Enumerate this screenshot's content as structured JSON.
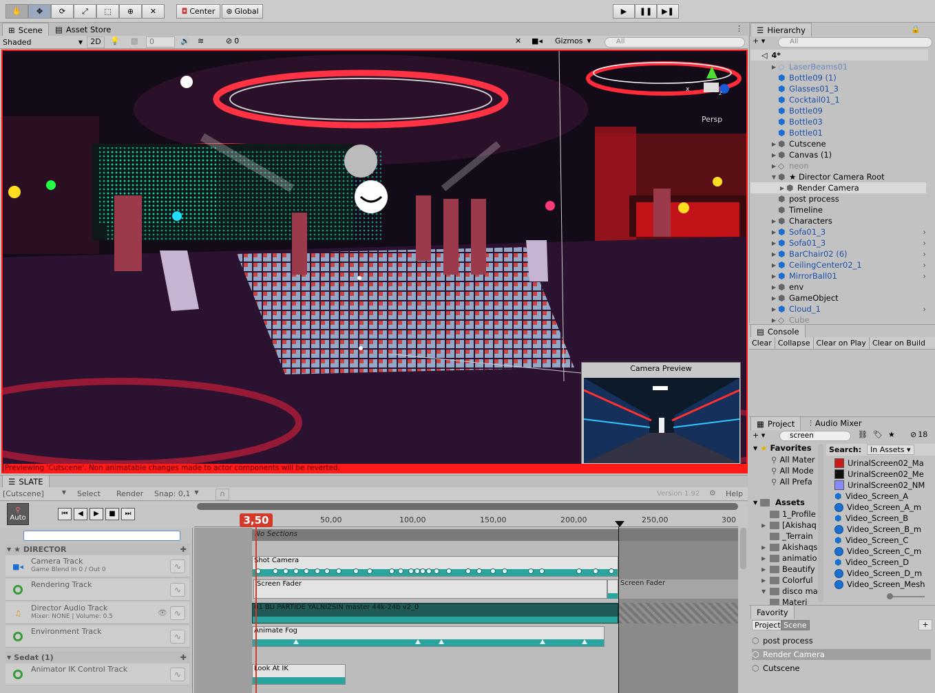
{
  "toolbar": {
    "tools": [
      "hand-tool",
      "move-tool",
      "rotate-tool",
      "scale-tool",
      "rect-tool",
      "transform-tool",
      "custom-tool"
    ],
    "pivot": "Center",
    "space": "Global"
  },
  "scene": {
    "tabs": [
      "Scene",
      "Asset Store"
    ],
    "shading": "Shaded",
    "mode2d": "2D",
    "counter": "0",
    "hidden_count": "0",
    "gizmos": "Gizmos",
    "search_placeholder": "All",
    "persp": "Persp",
    "warning": "Previewing 'Cutscene'. Non animatable changes made to actor components will be reverted.",
    "camera_preview": "Camera Preview"
  },
  "hierarchy": {
    "title": "Hierarchy",
    "search_placeholder": "All",
    "scene_name": "4*",
    "items": [
      {
        "label": "LaserBeams01",
        "type": "prefab-disabled",
        "arrow": "▶"
      },
      {
        "label": "Bottle09 (1)",
        "type": "prefab",
        "arrow": ""
      },
      {
        "label": "Glasses01_3",
        "type": "prefab",
        "arrow": ""
      },
      {
        "label": "Cocktail01_1",
        "type": "prefab",
        "arrow": ""
      },
      {
        "label": "Bottle09",
        "type": "prefab",
        "arrow": ""
      },
      {
        "label": "Bottle03",
        "type": "prefab",
        "arrow": ""
      },
      {
        "label": "Bottle01",
        "type": "prefab",
        "arrow": ""
      },
      {
        "label": "Cutscene",
        "type": "object",
        "arrow": "▶"
      },
      {
        "label": "Canvas (1)",
        "type": "object",
        "arrow": "▶"
      },
      {
        "label": "neon",
        "type": "disabled",
        "arrow": "▶"
      },
      {
        "label": "★ Director Camera Root",
        "type": "object",
        "arrow": "▼"
      },
      {
        "label": "Render Camera",
        "type": "object-selected",
        "arrow": "▶"
      },
      {
        "label": "post process",
        "type": "object",
        "arrow": ""
      },
      {
        "label": "Timeline",
        "type": "object",
        "arrow": ""
      },
      {
        "label": "Characters",
        "type": "object",
        "arrow": "▶"
      },
      {
        "label": "Sofa01_3",
        "type": "prefab",
        "arrow": "▶"
      },
      {
        "label": "Sofa01_3",
        "type": "prefab",
        "arrow": "▶"
      },
      {
        "label": "BarChair02 (6)",
        "type": "prefab",
        "arrow": "▶"
      },
      {
        "label": "CeilingCenter02_1",
        "type": "prefab",
        "arrow": "▶"
      },
      {
        "label": "MirrorBall01",
        "type": "prefab",
        "arrow": "▶"
      },
      {
        "label": "env",
        "type": "object",
        "arrow": "▶"
      },
      {
        "label": "GameObject",
        "type": "object",
        "arrow": "▶"
      },
      {
        "label": "Cloud_1",
        "type": "prefab",
        "arrow": "▶"
      },
      {
        "label": "Cube",
        "type": "disabled",
        "arrow": "▶"
      }
    ]
  },
  "console": {
    "title": "Console",
    "buttons": [
      "Clear",
      "Collapse",
      "Clear on Play",
      "Clear on Build"
    ]
  },
  "project": {
    "tabs": [
      "Project",
      "Audio Mixer"
    ],
    "search": "screen",
    "count": "18",
    "search_label": "Search:",
    "search_scope": "In Assets",
    "favorites_title": "Favorites",
    "favorites": [
      "All Mater",
      "All Mode",
      "All Prefa"
    ],
    "assets_title": "Assets",
    "folders": [
      "1_Profile",
      "[Akishaq",
      "_Terrain",
      "Akishaqs",
      "animatio",
      "Beautify",
      "Colorful",
      "disco ma",
      "Materi"
    ],
    "results": [
      {
        "label": "UrinalScreen02_Ma",
        "kind": "swatch",
        "color": "#cc1a1a"
      },
      {
        "label": "UrinalScreen02_Me",
        "kind": "swatch",
        "color": "#111111"
      },
      {
        "label": "UrinalScreen02_NM",
        "kind": "swatch",
        "color": "#8888ff"
      },
      {
        "label": "Video_Screen_A",
        "kind": "prefab"
      },
      {
        "label": "Video_Screen_A_m",
        "kind": "sphere"
      },
      {
        "label": "Video_Screen_B",
        "kind": "prefab"
      },
      {
        "label": "Video_Screen_B_m",
        "kind": "sphere"
      },
      {
        "label": "Video_Screen_C",
        "kind": "prefab"
      },
      {
        "label": "Video_Screen_C_m",
        "kind": "sphere"
      },
      {
        "label": "Video_Screen_D",
        "kind": "prefab"
      },
      {
        "label": "Video_Screen_D_m",
        "kind": "sphere"
      },
      {
        "label": "Video_Screen_Mesh",
        "kind": "sphere"
      }
    ]
  },
  "favority": {
    "title": "Favority",
    "tabs": [
      "Project",
      "Scene"
    ],
    "add": "+",
    "items": [
      "post process",
      "Render Camera",
      "Cutscene"
    ]
  },
  "slate": {
    "title": "SLATE",
    "cutscene": "[Cutscene]",
    "select": "Select",
    "render": "Render",
    "snap": "Snap: 0,1",
    "version": "Version 1.92",
    "help": "Help",
    "auto": "Auto",
    "current_time": "3,50",
    "ruler": [
      "50,00",
      "100,00",
      "150,00",
      "200,00",
      "250,00",
      "300"
    ],
    "sections": "No Sections",
    "groups": [
      {
        "name": "★ DIRECTOR"
      },
      {
        "name": "Sedat (1)"
      }
    ],
    "tracks": [
      {
        "name": "Camera Track",
        "sub": "Game Blend In 0 / Out 0",
        "icon": "camera-icon"
      },
      {
        "name": "Rendering Track",
        "sub": "",
        "icon": "circle-icon"
      },
      {
        "name": "Director Audio Track",
        "sub": "Mixer: NONE | Volume: 0.5",
        "icon": "audio-icon"
      },
      {
        "name": "Environment Track",
        "sub": "",
        "icon": "circle-icon"
      },
      {
        "name": "Animator IK Control Track",
        "sub": "",
        "icon": "circle-icon"
      }
    ],
    "clips": {
      "shot": "Shot Camera",
      "fader1": "Screen Fader",
      "fader2": "Screen Fader",
      "audio": "01 BU PARTIDE YALNIZSIN  master 44k-24b v2_0",
      "fog": "Animate Fog",
      "look": "Look At IK"
    }
  },
  "colors": {
    "selection_red": "#ff1a1a",
    "teal": "#2aa49e",
    "prefab_blue": "#1c4fa8",
    "playhead": "#d23a2a"
  }
}
